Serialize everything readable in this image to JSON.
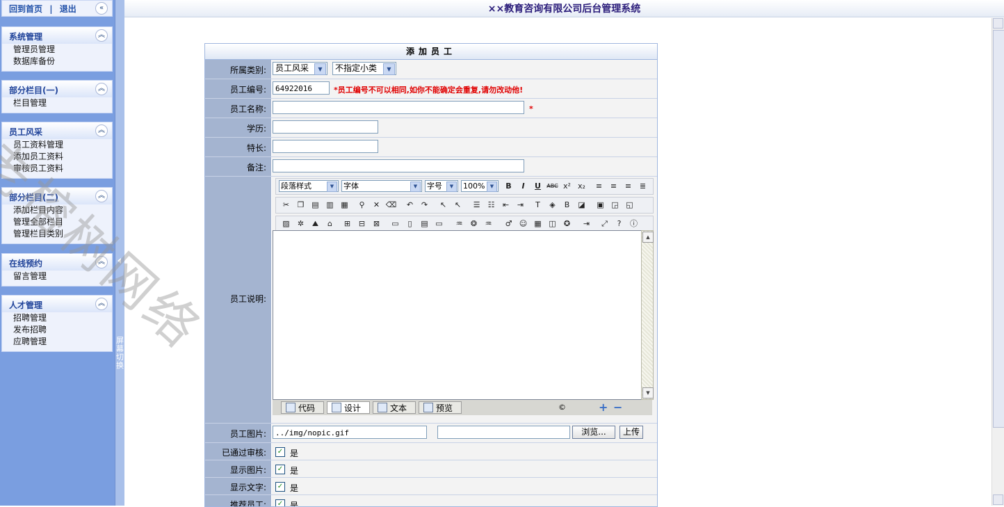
{
  "header": {
    "title": "××教育咨询有限公司后台管理系统"
  },
  "sidebar": {
    "top_links": {
      "home": "回到首页",
      "sep": "|",
      "logout": "退出",
      "toggle": "«"
    },
    "groups": [
      {
        "title": "系统管理",
        "items": [
          "管理员管理",
          "数据库备份"
        ]
      },
      {
        "title": "部分栏目(一)",
        "items": [
          "栏目管理"
        ]
      },
      {
        "title": "员工风采",
        "items": [
          "员工资料管理",
          "添加员工资料",
          "审核员工资料"
        ]
      },
      {
        "title": "部分栏目(二)",
        "items": [
          "添加栏目内容",
          "管理全部栏目",
          "管理栏目类别"
        ]
      },
      {
        "title": "在线预约",
        "items": [
          "留言管理"
        ]
      },
      {
        "title": "人才管理",
        "items": [
          "招聘管理",
          "发布招聘",
          "应聘管理"
        ]
      }
    ],
    "switch_text": "屏幕切换"
  },
  "watermark": "老榕树网络",
  "form": {
    "title": "添加员工",
    "category": {
      "label": "所属类别:",
      "value1": "员工风采",
      "value2": "不指定小类"
    },
    "number": {
      "label": "员工编号:",
      "value": "64922016",
      "hint": "*员工编号不可以相同,如你不能确定会重复,请勿改动他!"
    },
    "name": {
      "label": "员工名称:",
      "value": "",
      "required": "*"
    },
    "education": {
      "label": "学历:",
      "value": ""
    },
    "specialty": {
      "label": "特长:",
      "value": ""
    },
    "remark": {
      "label": "备注:",
      "value": ""
    },
    "description": {
      "label": "员工说明:"
    },
    "editor": {
      "selects": {
        "style": "段落样式",
        "font": "字体",
        "size": "字号",
        "zoom": "100%"
      },
      "modes": [
        "代码",
        "设计",
        "文本",
        "预览"
      ],
      "active_mode": "设计",
      "copyright": "©"
    },
    "photo": {
      "label": "员工图片:",
      "value": "../img/nopic.gif",
      "file_value": "",
      "browse": "浏览...",
      "upload": "上传"
    },
    "approved": {
      "label": "已通过审核:",
      "option": "是",
      "checked": true
    },
    "show_image": {
      "label": "显示图片:",
      "option": "是",
      "checked": true
    },
    "show_text": {
      "label": "显示文字:",
      "option": "是",
      "checked": true
    },
    "recommend": {
      "label": "推荐员工:",
      "option": "是",
      "checked": true
    }
  }
}
